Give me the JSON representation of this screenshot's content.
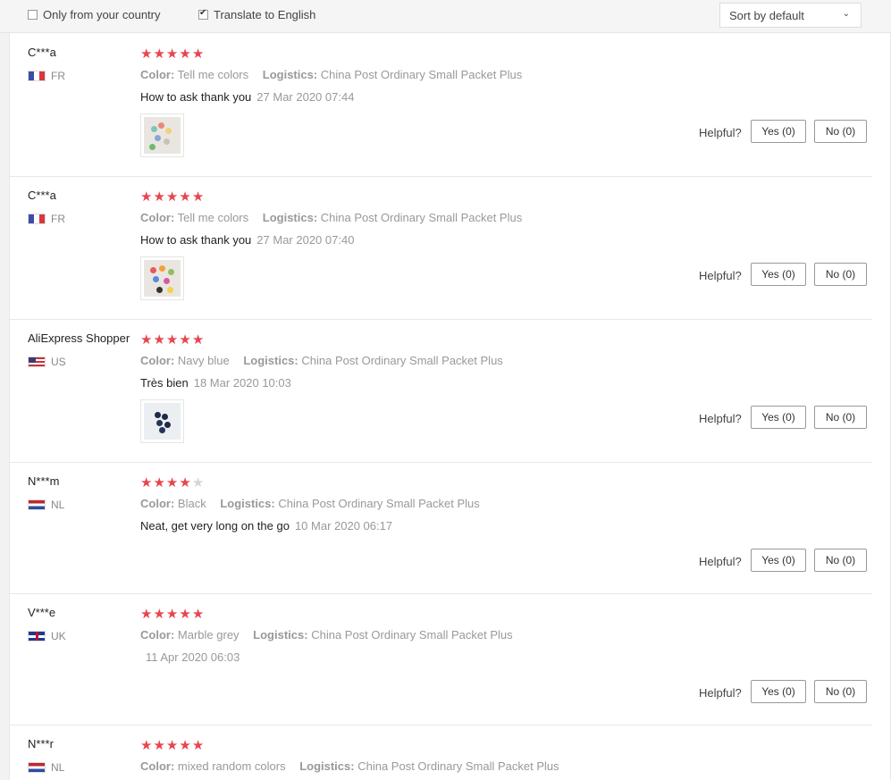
{
  "filters": {
    "only_country_label": "Only from your country",
    "translate_label": "Translate to English",
    "sort_label": "Sort by default"
  },
  "labels": {
    "color": "Color:",
    "logistics": "Logistics:",
    "helpful": "Helpful?"
  },
  "reviews": [
    {
      "user": "C***a",
      "country": "FR",
      "stars": 5,
      "color": "Tell me colors",
      "logistics": "China Post Ordinary Small Packet Plus",
      "text": "How to ask thank you",
      "date": "27 Mar 2020 07:44",
      "yes": "Yes (0)",
      "no": "No (0)",
      "has_photo": true
    },
    {
      "user": "C***a",
      "country": "FR",
      "stars": 5,
      "color": "Tell me colors",
      "logistics": "China Post Ordinary Small Packet Plus",
      "text": "How to ask thank you",
      "date": "27 Mar 2020 07:40",
      "yes": "Yes (0)",
      "no": "No (0)",
      "has_photo": true
    },
    {
      "user": "AliExpress Shopper",
      "country": "US",
      "stars": 5,
      "color": "Navy blue",
      "logistics": "China Post Ordinary Small Packet Plus",
      "text": "Très bien",
      "date": "18 Mar 2020 10:03",
      "yes": "Yes (0)",
      "no": "No (0)",
      "has_photo": true
    },
    {
      "user": "N***m",
      "country": "NL",
      "stars": 4,
      "color": "Black",
      "logistics": "China Post Ordinary Small Packet Plus",
      "text": "Neat, get very long on the go",
      "date": "10 Mar 2020 06:17",
      "yes": "Yes (0)",
      "no": "No (0)",
      "has_photo": false
    },
    {
      "user": "V***e",
      "country": "UK",
      "stars": 5,
      "color": "Marble grey",
      "logistics": "China Post Ordinary Small Packet Plus",
      "text": "",
      "date": "11 Apr 2020 06:03",
      "yes": "Yes (0)",
      "no": "No (0)",
      "has_photo": false
    },
    {
      "user": "N***r",
      "country": "NL",
      "stars": 5,
      "color": "mixed random colors",
      "logistics": "China Post Ordinary Small Packet Plus",
      "text": "",
      "date": "",
      "yes": "",
      "no": "",
      "has_photo": false
    }
  ],
  "icons": {
    "star": "star-icon",
    "chevron": "chevron-down-icon",
    "checkbox": "checkbox-icon"
  },
  "colors": {
    "star_active": "#e8454f",
    "star_inactive": "#d5d5d5"
  }
}
